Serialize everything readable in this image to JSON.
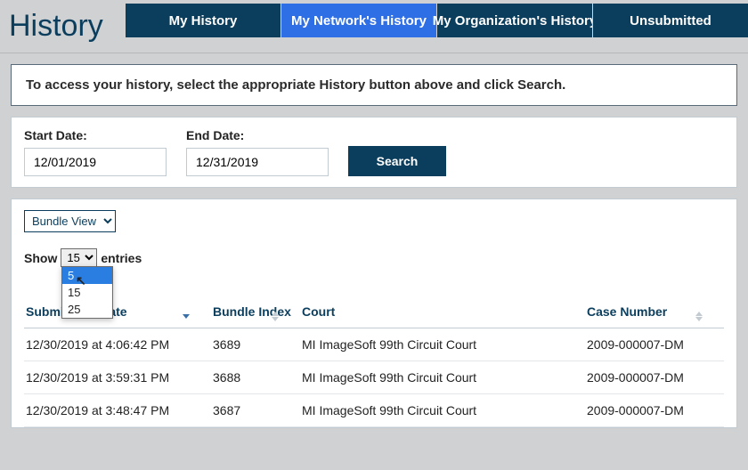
{
  "page_title": "History",
  "tabs": [
    {
      "label": "My History",
      "active": false
    },
    {
      "label": "My Network's History",
      "active": true
    },
    {
      "label": "My Organization's History",
      "active": false
    },
    {
      "label": "Unsubmitted",
      "active": false
    }
  ],
  "instruction": "To access your history, select the appropriate History button above and click Search.",
  "filters": {
    "start_label": "Start Date:",
    "end_label": "End Date:",
    "start_value": "12/01/2019",
    "end_value": "12/31/2019",
    "search_label": "Search"
  },
  "view_select": "Bundle View",
  "show_prefix": "Show",
  "show_suffix": "entries",
  "entries_selected": "15",
  "entries_options": [
    "5",
    "15",
    "25"
  ],
  "entries_highlight_index": 0,
  "columns": {
    "submission": "Submission Date",
    "bundle": "Bundle Index",
    "court": "Court",
    "case": "Case Number"
  },
  "rows": [
    {
      "submission": "12/30/2019 at 4:06:42 PM",
      "bundle": "3689",
      "court": "MI ImageSoft 99th Circuit Court",
      "case": "2009-000007-DM"
    },
    {
      "submission": "12/30/2019 at 3:59:31 PM",
      "bundle": "3688",
      "court": "MI ImageSoft 99th Circuit Court",
      "case": "2009-000007-DM"
    },
    {
      "submission": "12/30/2019 at 3:48:47 PM",
      "bundle": "3687",
      "court": "MI ImageSoft 99th Circuit Court",
      "case": "2009-000007-DM"
    }
  ]
}
